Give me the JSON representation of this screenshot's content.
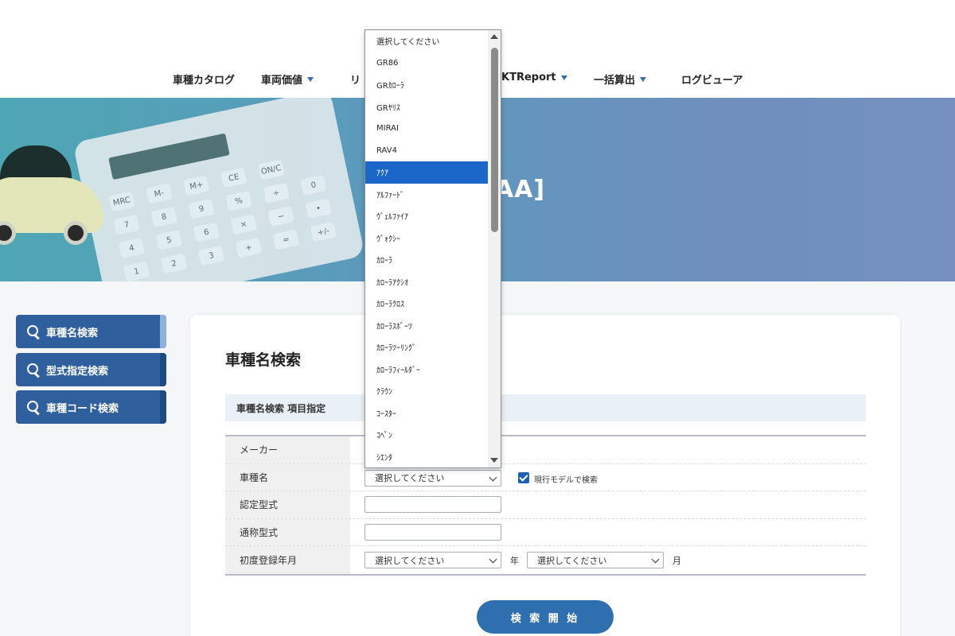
{
  "nav": {
    "items": [
      {
        "label": "車種カタログ",
        "dropdown": false
      },
      {
        "label": "車両価値",
        "dropdown": true
      },
      {
        "label": "リ",
        "dropdown": false
      },
      {
        "label": "KTReport",
        "dropdown": true
      },
      {
        "label": "一括算出",
        "dropdown": true
      },
      {
        "label": "ログビューア",
        "dropdown": false
      }
    ]
  },
  "hero": {
    "title_fragment": "AA]",
    "calculator_keys": [
      "MRC",
      "M-",
      "M+",
      "CE",
      "ON/C",
      "7",
      "8",
      "9",
      "%",
      "÷",
      "4",
      "5",
      "6",
      "×",
      "−",
      "1",
      "2",
      "3",
      "+",
      "=",
      "0",
      "•",
      "+/-"
    ]
  },
  "sidebar": {
    "items": [
      {
        "label": "車種名検索"
      },
      {
        "label": "型式指定検索"
      },
      {
        "label": "車種コード検索"
      }
    ]
  },
  "main": {
    "title": "車種名検索",
    "section_label": "車種名検索 項目指定",
    "rows": {
      "maker": {
        "label": "メーカー"
      },
      "model_name": {
        "label": "車種名",
        "value": "選択してください",
        "checkbox_label": "現行モデルで検索",
        "checked": true
      },
      "certified_type": {
        "label": "認定型式",
        "value": ""
      },
      "common_type": {
        "label": "通称型式",
        "value": ""
      },
      "first_registration": {
        "label": "初度登録年月",
        "year_value": "選択してください",
        "year_unit": "年",
        "month_value": "選択してください",
        "month_unit": "月"
      }
    },
    "search_button_label": "検 索 開 始"
  },
  "dropdown": {
    "selected_index": 6,
    "options": [
      "選択してください",
      "GR86",
      "GRｶﾛｰﾗ",
      "GRﾔﾘｽ",
      "MIRAI",
      "RAV4",
      "ｱｸｱ",
      "ｱﾙﾌｧｰﾄﾞ",
      "ｳﾞｪﾙﾌｧｲｱ",
      "ｳﾞｫｸｼｰ",
      "ｶﾛｰﾗ",
      "ｶﾛｰﾗｱｸｼｵ",
      "ｶﾛｰﾗｸﾛｽ",
      "ｶﾛｰﾗｽﾎﾟｰﾂ",
      "ｶﾛｰﾗﾂｰﾘﾝｸﾞ",
      "ｶﾛｰﾗﾌｨｰﾙﾀﾞｰ",
      "ｸﾗｳﾝ",
      "ｺｰｽﾀｰ",
      "ｺﾍﾟﾝ",
      "ｼｴﾝﾀ"
    ]
  },
  "colors": {
    "primary": "#2f5f9c",
    "accent": "#1b66c9",
    "button": "#2f6fb0",
    "section_bg": "#eaf0f7"
  }
}
